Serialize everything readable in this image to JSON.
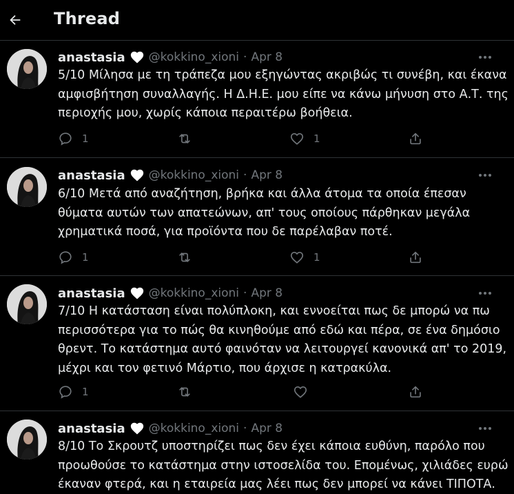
{
  "header": {
    "title": "Thread",
    "back_icon": "arrow-left-icon"
  },
  "colors": {
    "background": "#000000",
    "text": "#e7e9ea",
    "secondary": "#71767b",
    "divider": "#2f3336"
  },
  "tweets": [
    {
      "name": "anastasia",
      "badge_icon": "white-heart-icon",
      "handle": "@kokkino_xioni",
      "dot": "·",
      "date": "Apr 8",
      "lines": [
        "5/10 Μίλησα με τη τράπεζα μου εξηγώντας ακριβώς τι συνέβη, και έκανα",
        "αμφισβήτηση συναλλαγής. Η Δ.Η.Ε. μου είπε να κάνω μήνυση στο Α.Τ. της",
        "περιοχής μου, χωρίς κάποια περαιτέρω βοήθεια."
      ],
      "replies": "1",
      "retweets": "",
      "likes": "1"
    },
    {
      "name": "anastasia",
      "badge_icon": "white-heart-icon",
      "handle": "@kokkino_xioni",
      "dot": "·",
      "date": "Apr 8",
      "lines": [
        "6/10 Μετά από αναζήτηση, βρήκα και άλλα άτομα τα οποία έπεσαν",
        "θύματα αυτών των απατεώνων, απ' τους οποίους πάρθηκαν μεγάλα",
        "χρηματικά ποσά, για προϊόντα που δε παρέλαβαν ποτέ."
      ],
      "replies": "1",
      "retweets": "",
      "likes": "1"
    },
    {
      "name": "anastasia",
      "badge_icon": "white-heart-icon",
      "handle": "@kokkino_xioni",
      "dot": "·",
      "date": "Apr 8",
      "lines": [
        "7/10 Η κατάσταση είναι πολύπλοκη, και εννοείται πως δε μπορώ να πω",
        "περισσότερα για το πώς θα κινηθούμε από εδώ και πέρα, σε ένα δημόσιο",
        "θρεντ. Το κατάστημα αυτό φαινόταν να λειτουργεί κανονικά απ' το 2019,",
        "μέχρι και τον φετινό Μάρτιο, που άρχισε η κατρακύλα."
      ],
      "replies": "1",
      "retweets": "",
      "likes": ""
    },
    {
      "name": "anastasia",
      "badge_icon": "white-heart-icon",
      "handle": "@kokkino_xioni",
      "dot": "·",
      "date": "Apr 8",
      "lines": [
        "8/10 Το Σκρουτζ υποστηρίζει πως δεν έχει κάποια ευθύνη, παρόλο που",
        "προωθούσε το κατάστημα στην ιστοσελίδα του. Επομένως, χιλιάδες ευρώ",
        "έκαναν φτερά, και η εταιρεία μας λέει πως δεν μπορεί να κάνει ΤΙΠΟΤΑ."
      ],
      "replies": "",
      "retweets": "",
      "likes": ""
    }
  ]
}
